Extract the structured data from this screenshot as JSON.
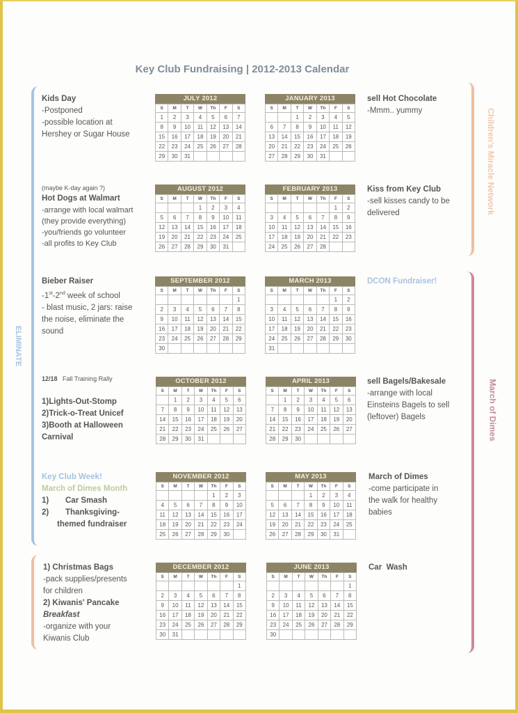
{
  "title": "Key Club Fundraising | 2012-2013 Calendar",
  "colors": {
    "frame": "#e0c44a",
    "title": "#7f8c9a",
    "calendar_header": "#8d8466",
    "eliminate": "#a8c2e2",
    "childrens_miracle": "#f0bf9e",
    "march_of_dimes": "#cf8794",
    "december_bracket": "#f0bf9e"
  },
  "side_labels": {
    "eliminate": "ELIMINATE",
    "childrens_miracle_network": "Children's Miracle Network",
    "march_of_dimes": "March of Dimes"
  },
  "day_headers": [
    "S",
    "M",
    "T",
    "W",
    "Th",
    "F",
    "S"
  ],
  "calendars": [
    {
      "label": "JULY 2012",
      "start": 0,
      "days": 31
    },
    {
      "label": "JANUARY 2013",
      "start": 2,
      "days": 31
    },
    {
      "label": "AUGUST 2012",
      "start": 3,
      "days": 31
    },
    {
      "label": "FEBRUARY 2013",
      "start": 5,
      "days": 28
    },
    {
      "label": "SEPTEMBER 2012",
      "start": 6,
      "days": 30
    },
    {
      "label": "MARCH 2013",
      "start": 5,
      "days": 31
    },
    {
      "label": "OCTOBER 2012",
      "start": 1,
      "days": 31
    },
    {
      "label": "APRIL 2013",
      "start": 1,
      "days": 30
    },
    {
      "label": "NOVEMBER 2012",
      "start": 4,
      "days": 30
    },
    {
      "label": "MAY 2013",
      "start": 3,
      "days": 31
    },
    {
      "label": "DECEMBER 2012",
      "start": 6,
      "days": 31
    },
    {
      "label": "JUNE 2013",
      "start": 6,
      "days": 30
    }
  ],
  "left_notes": {
    "july": {
      "title": "Kids Day",
      "line1": "-Postponed",
      "line2": "-possible location at",
      "line3": "Hershey or Sugar House"
    },
    "august": {
      "pre": "(maybe K-day again ?)",
      "title": "Hot Dogs at Walmart",
      "line1": "-arrange with local walmart",
      "line2": "(they provide everything)",
      "line3": "-you/friends go volunteer",
      "line4": "-all profits to Key Club"
    },
    "september": {
      "title": "Bieber Raiser",
      "line1_a": "-1",
      "line1_sup1": "st",
      "line1_b": "-2",
      "line1_sup2": "nd",
      "line1_c": " week of school",
      "line2": "- blast music, 2 jars: raise",
      "line3": "the noise, eliminate the",
      "line4": "sound"
    },
    "october": {
      "date": "12/18",
      "event": "Fall Training Rally",
      "item1": "1)Lights-Out-Stomp",
      "item2": "2)Trick-o-Treat Unicef",
      "item3": "3)Booth at Halloween",
      "item3b": "Carnival"
    },
    "november": {
      "title1": "Key Club Week!",
      "title2": "March of Dimes Month",
      "n1": "1)",
      "item1": "Car Smash",
      "n2": "2)",
      "item2": "Thanksgiving-",
      "item2b": "themed fundraiser"
    },
    "december": {
      "item1": "1) Christmas Bags",
      "line1": "-pack supplies/presents",
      "line2": "for children",
      "item2": "2) Kiwanis' Pancake",
      "item2b": "Breakfast",
      "line3": "-organize with your",
      "line4": "Kiwanis Club"
    }
  },
  "right_notes": {
    "january": {
      "title": "sell Hot Chocolate",
      "line1": "-Mmm.. yummy"
    },
    "february": {
      "title": "Kiss from Key Club",
      "line1": "-sell kisses candy to be",
      "line2": "delivered"
    },
    "march": {
      "title": "DCON Fundraiser!"
    },
    "april": {
      "title": "sell Bagels/Bakesale",
      "line1": "-arrange with local",
      "line2": "Einsteins Bagels to sell",
      "line3": "(leftover) Bagels"
    },
    "may": {
      "title": "March of Dimes",
      "line1": "-come participate in",
      "line2": "the walk for healthy",
      "line3": "babies"
    },
    "june": {
      "title": "Car  Wash"
    }
  }
}
